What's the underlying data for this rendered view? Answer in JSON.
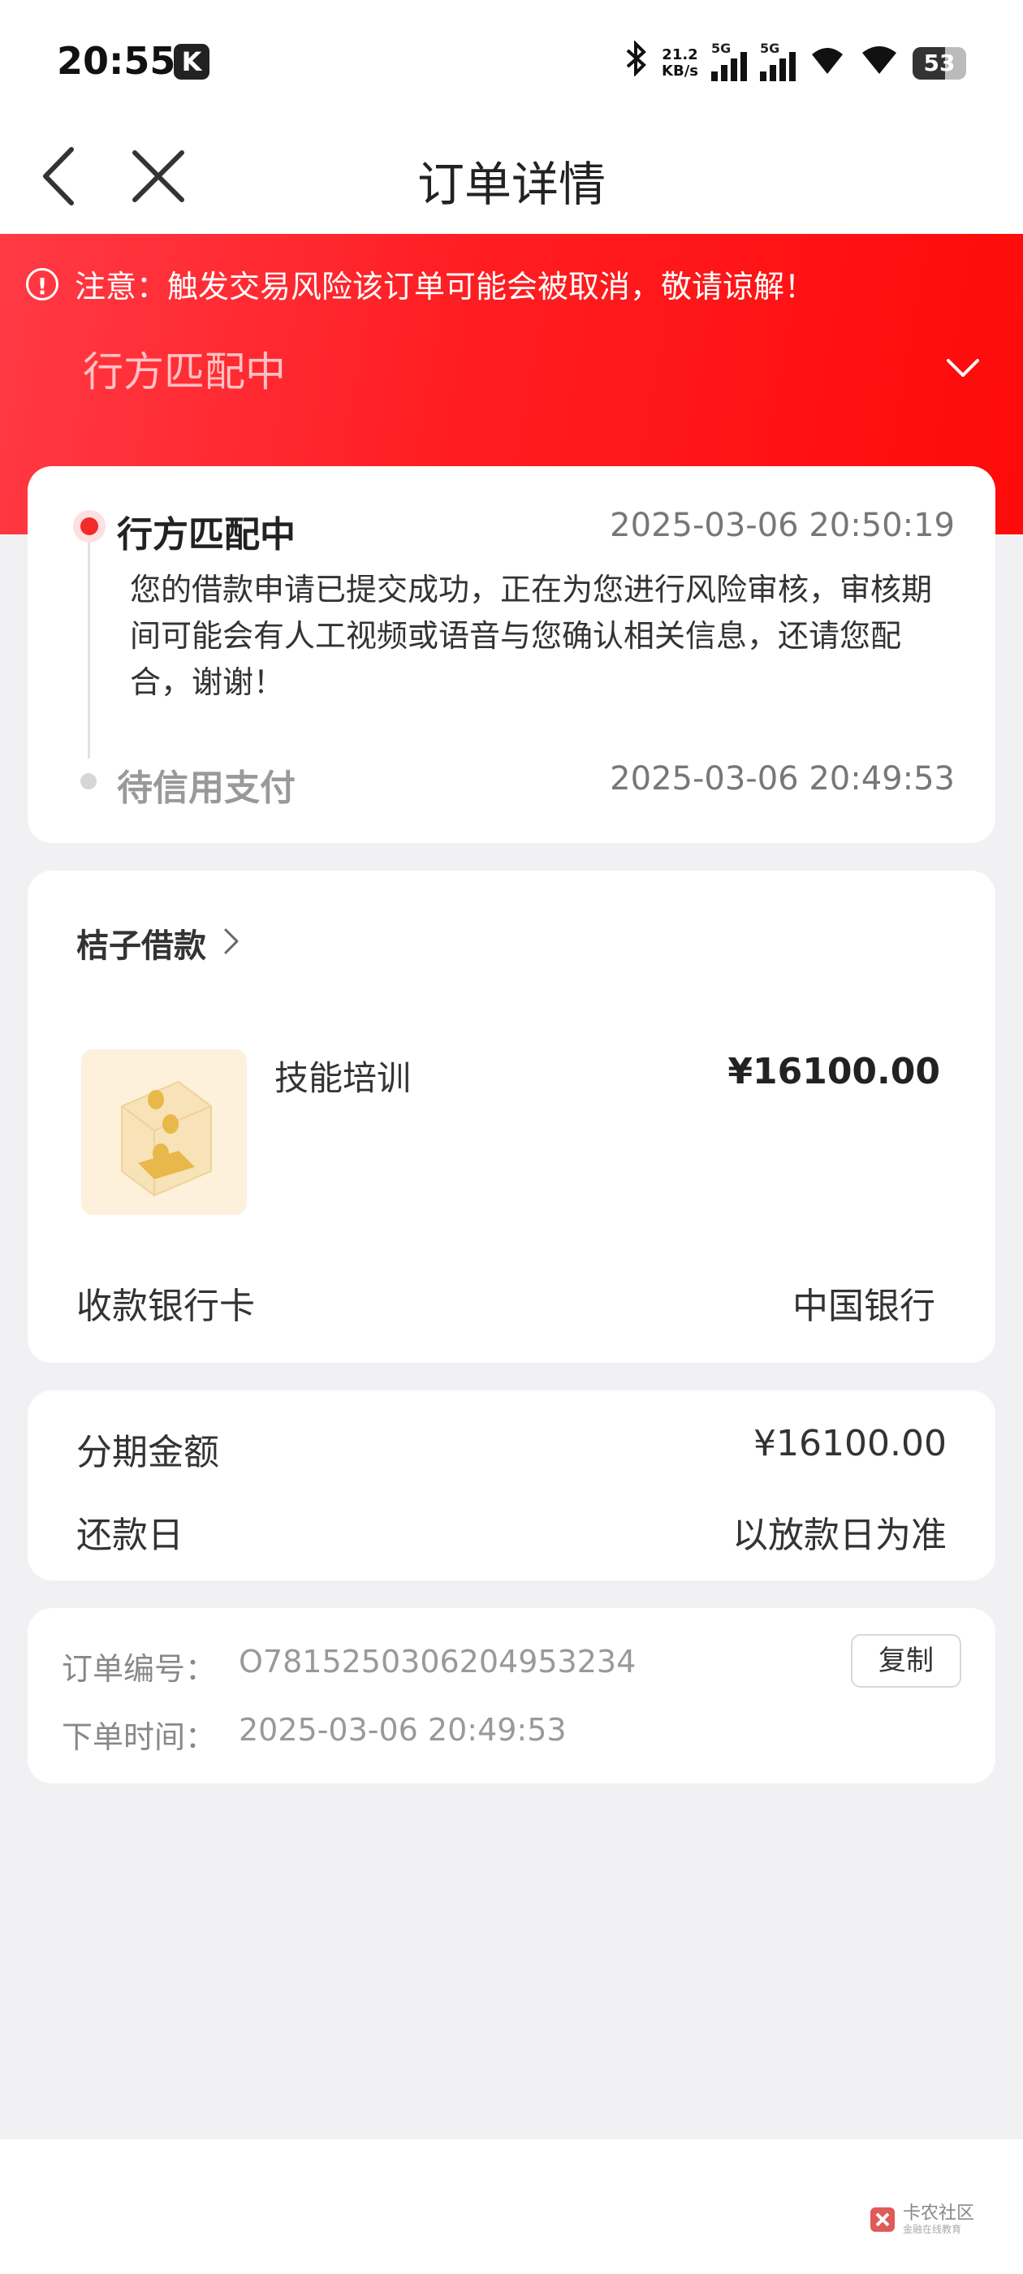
{
  "status_bar": {
    "time": "20:55",
    "app_badge": "K",
    "net_speed_value": "21.2",
    "net_speed_unit": "KB/s",
    "sig1_label": "5G",
    "sig2_label": "5G",
    "battery": "53",
    "icons": [
      "bluetooth-icon",
      "signal-icon",
      "signal-icon",
      "wifi-icon",
      "wifi-icon",
      "battery-icon"
    ]
  },
  "nav": {
    "title": "订单详情",
    "icons": [
      "back-arrow-icon",
      "close-icon"
    ]
  },
  "banner": {
    "notice": "注意：触发交易风险该订单可能会被取消，敬请谅解！",
    "status": "行方匹配中",
    "bg_color": "#ff1d22"
  },
  "timeline": [
    {
      "title": "行方匹配中",
      "time": "2025-03-06 20:50:19",
      "description": "您的借款申请已提交成功，正在为您进行风险审核，审核期间可能会有人工视频或语音与您确认相关信息，还请您配合，谢谢！"
    },
    {
      "title": "待信用支付",
      "time": "2025-03-06 20:49:53"
    }
  ],
  "product": {
    "merchant": "桔子借款",
    "name": "技能培训",
    "price": "¥16100.00",
    "bank_label": "收款银行卡",
    "bank_value": "中国银行"
  },
  "installment": {
    "amount_label": "分期金额",
    "amount_value": "¥16100.00",
    "repay_label": "还款日",
    "repay_value": "以放款日为准"
  },
  "order": {
    "number_label": "订单编号：",
    "number_value": "O781525030620495323​4",
    "time_label": "下单时间：",
    "time_value": "2025-03-06 20:49:53",
    "copy_label": "复制"
  },
  "watermark": {
    "line1": "卡农社区",
    "line2": "金融在线教育"
  }
}
